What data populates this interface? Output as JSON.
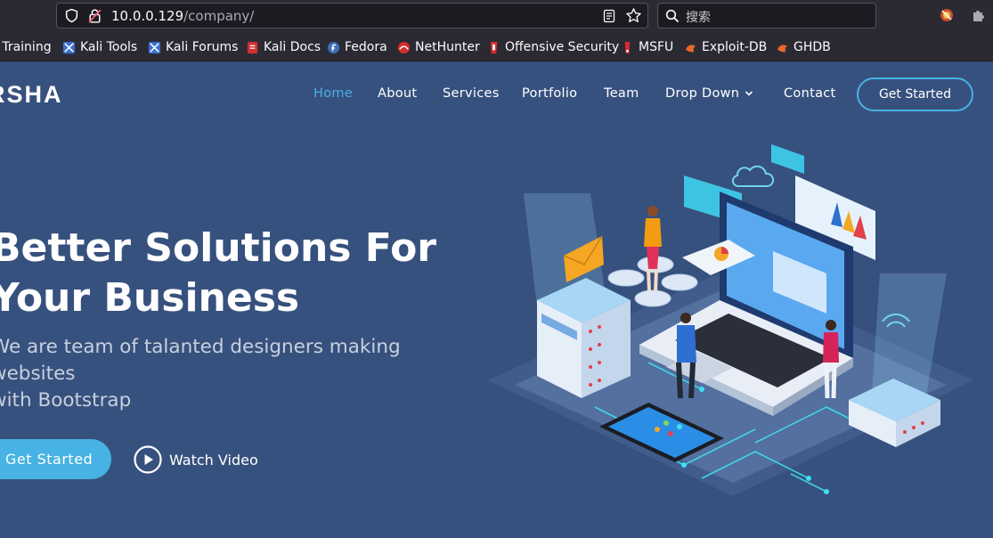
{
  "browser": {
    "url_host": "10.0.0.129",
    "url_path": "/company/",
    "search_placeholder": "搜索",
    "bookmarks": [
      {
        "label": "i Training",
        "icon": "kali-icon"
      },
      {
        "label": "Kali Tools",
        "icon": "kali-tools-icon"
      },
      {
        "label": "Kali Forums",
        "icon": "kali-forums-icon"
      },
      {
        "label": "Kali Docs",
        "icon": "kali-docs-icon"
      },
      {
        "label": "Fedora",
        "icon": "fedora-icon"
      },
      {
        "label": "NetHunter",
        "icon": "nethunter-icon"
      },
      {
        "label": "Offensive Security",
        "icon": "offsec-icon"
      },
      {
        "label": "MSFU",
        "icon": "msfu-icon"
      },
      {
        "label": "Exploit-DB",
        "icon": "exploitdb-icon"
      },
      {
        "label": "GHDB",
        "icon": "ghdb-icon"
      }
    ]
  },
  "site": {
    "logo": "RSHA",
    "nav": [
      {
        "label": "Home",
        "active": true
      },
      {
        "label": "About"
      },
      {
        "label": "Services"
      },
      {
        "label": "Portfolio"
      },
      {
        "label": "Team"
      },
      {
        "label": "Drop Down"
      },
      {
        "label": "Contact"
      }
    ],
    "nav_button": "Get Started",
    "hero": {
      "title_line1": "Better Solutions For",
      "title_line2": "Your Business",
      "subtitle_line1": "We are team of talanted designers making websites",
      "subtitle_line2": "with Bootstrap",
      "cta": "Get Started",
      "watch_video": "Watch Video"
    }
  },
  "colors": {
    "page_bg": "#37517e",
    "accent": "#47b2e4",
    "chrome_bg": "#2b2a33"
  }
}
